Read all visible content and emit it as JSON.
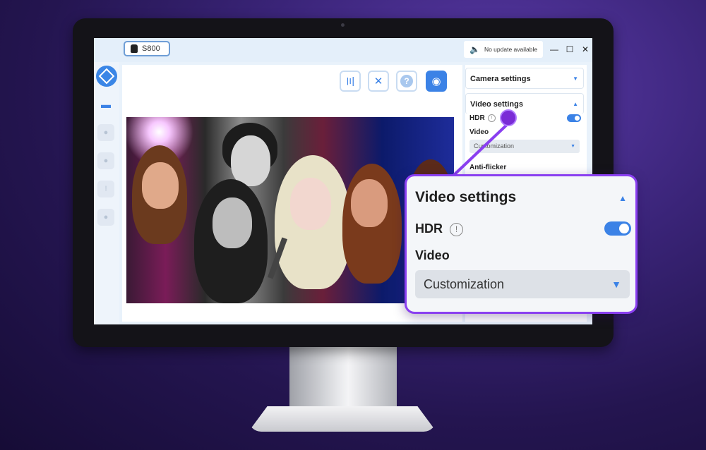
{
  "app": {
    "device_name": "S800",
    "update_status": "No update available",
    "window_controls": {
      "minimize": "—",
      "maximize": "☐",
      "close": "✕"
    }
  },
  "sidebar": {
    "items": [
      {
        "icon": "monitor-icon",
        "glyph": "▬",
        "active": true
      },
      {
        "icon": "settings-icon",
        "glyph": "●",
        "active": false
      },
      {
        "icon": "bell-icon",
        "glyph": "●",
        "active": false
      },
      {
        "icon": "info-icon",
        "glyph": "!",
        "active": false
      },
      {
        "icon": "user-icon",
        "glyph": "●",
        "active": false
      }
    ]
  },
  "toolbar": {
    "audio_icon": "〣",
    "tools_icon": "✕",
    "help_icon": "?",
    "preview_icon": "◉"
  },
  "settings_panel": {
    "camera_settings": "Camera settings",
    "video_settings": "Video settings",
    "hdr_label": "HDR",
    "hdr_info": "!",
    "video_label": "Video",
    "video_value": "Customization",
    "anti_flicker_label": "Anti-flicker",
    "collapse_glyph": "▲",
    "expand_glyph": "▼"
  },
  "callout": {
    "title": "Video settings",
    "hdr_label": "HDR",
    "hdr_info": "!",
    "hdr_enabled": true,
    "video_label": "Video",
    "video_value": "Customization",
    "collapse_glyph": "▲",
    "dropdown_glyph": "▼"
  },
  "colors": {
    "accent": "#3b82e6",
    "callout_border": "#8a3ff0",
    "background": "#2a1a5e"
  }
}
